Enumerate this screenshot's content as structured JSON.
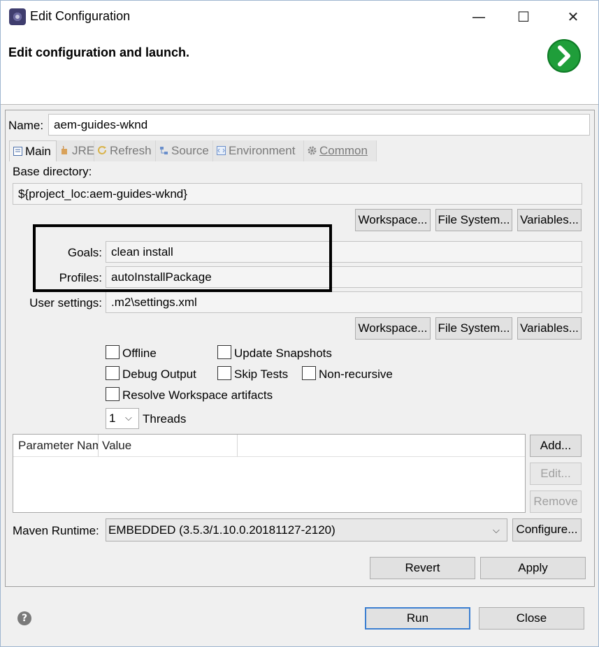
{
  "window": {
    "title": "Edit Configuration",
    "minimize_glyph": "—",
    "maximize_glyph": "☐",
    "close_glyph": "✕"
  },
  "banner": {
    "title": "Edit configuration and launch."
  },
  "name": {
    "label": "Name:",
    "value": "aem-guides-wknd"
  },
  "tabs": [
    {
      "label": "Main",
      "icon": "main-tab-icon",
      "active": true
    },
    {
      "label": "JRE",
      "icon": "jre-icon",
      "active": false
    },
    {
      "label": "Refresh",
      "icon": "refresh-icon",
      "active": false
    },
    {
      "label": "Source",
      "icon": "source-icon",
      "active": false
    },
    {
      "label": "Environment",
      "icon": "environment-icon",
      "active": false
    },
    {
      "label": "Common",
      "icon": "common-icon",
      "active": false
    }
  ],
  "base_directory": {
    "label": "Base directory:",
    "value": "${project_loc:aem-guides-wknd}",
    "buttons": [
      "Workspace...",
      "File System...",
      "Variables..."
    ]
  },
  "goals": {
    "label": "Goals:",
    "value": "clean install"
  },
  "profiles": {
    "label": "Profiles:",
    "value": "autoInstallPackage"
  },
  "user_settings": {
    "label": "User settings:",
    "value": ".m2\\settings.xml",
    "buttons": [
      "Workspace...",
      "File System...",
      "Variables..."
    ]
  },
  "options": {
    "offline": "Offline",
    "update_snapshots": "Update Snapshots",
    "debug_output": "Debug Output",
    "skip_tests": "Skip Tests",
    "non_recursive": "Non-recursive",
    "resolve_workspace": "Resolve Workspace artifacts"
  },
  "threads": {
    "value": "1",
    "label": "Threads"
  },
  "parameters": {
    "columns": [
      "Parameter Name",
      "Value"
    ],
    "buttons": {
      "add": "Add...",
      "edit": "Edit...",
      "remove": "Remove"
    }
  },
  "runtime": {
    "label": "Maven Runtime:",
    "value": "EMBEDDED (3.5.3/1.10.0.20181127-2120)",
    "configure": "Configure..."
  },
  "actions": {
    "revert": "Revert",
    "apply": "Apply",
    "run": "Run",
    "close": "Close"
  },
  "colors": {
    "accent": "#1f9e3a",
    "focus": "#3c7fd1"
  }
}
